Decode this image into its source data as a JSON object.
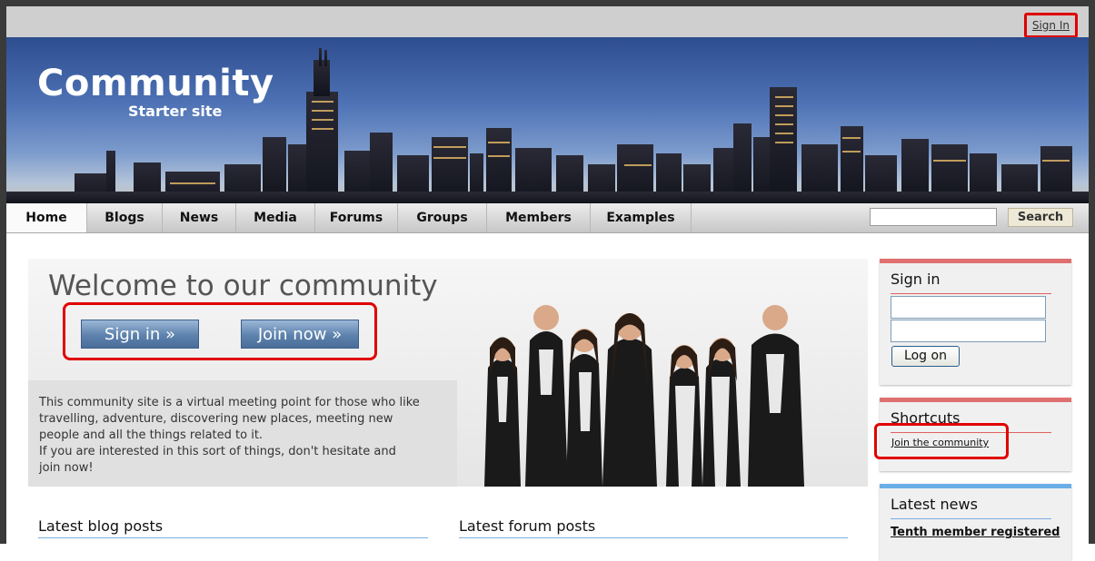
{
  "header": {
    "sign_in_link": "Sign In"
  },
  "logo": {
    "title": "Community",
    "subtitle": "Starter site"
  },
  "nav": {
    "items": [
      {
        "label": "Home"
      },
      {
        "label": "Blogs"
      },
      {
        "label": "News"
      },
      {
        "label": "Media"
      },
      {
        "label": "Forums"
      },
      {
        "label": "Groups"
      },
      {
        "label": "Members"
      },
      {
        "label": "Examples"
      }
    ],
    "active": "Home",
    "search_button": "Search",
    "search_value": ""
  },
  "welcome": {
    "title": "Welcome to our community",
    "sign_in_button": "Sign in »",
    "join_button": "Join now »",
    "text_line1": "This community site is a virtual meeting point for those who like",
    "text_line2": "travelling, adventure, discovering new places, meeting new",
    "text_line3": "people and all the things related to it.",
    "text_line4": "If you are interested in this sort of things, don't hesitate and",
    "text_line5": "join now!"
  },
  "signin_box": {
    "title": "Sign in",
    "username_value": "",
    "password_value": "",
    "logon_button": "Log on"
  },
  "shortcuts_box": {
    "title": "Shortcuts",
    "join_link": "Join the community"
  },
  "news_box": {
    "title": "Latest news",
    "first_item": "Tenth member registered"
  },
  "sections": {
    "blog_posts": "Latest blog posts",
    "forum_posts": "Latest forum posts"
  },
  "colors": {
    "accent_red": "#e00000",
    "box_top_red": "#e07070",
    "news_blue": "#6aaee8",
    "button_blue": "#5d82ad"
  }
}
